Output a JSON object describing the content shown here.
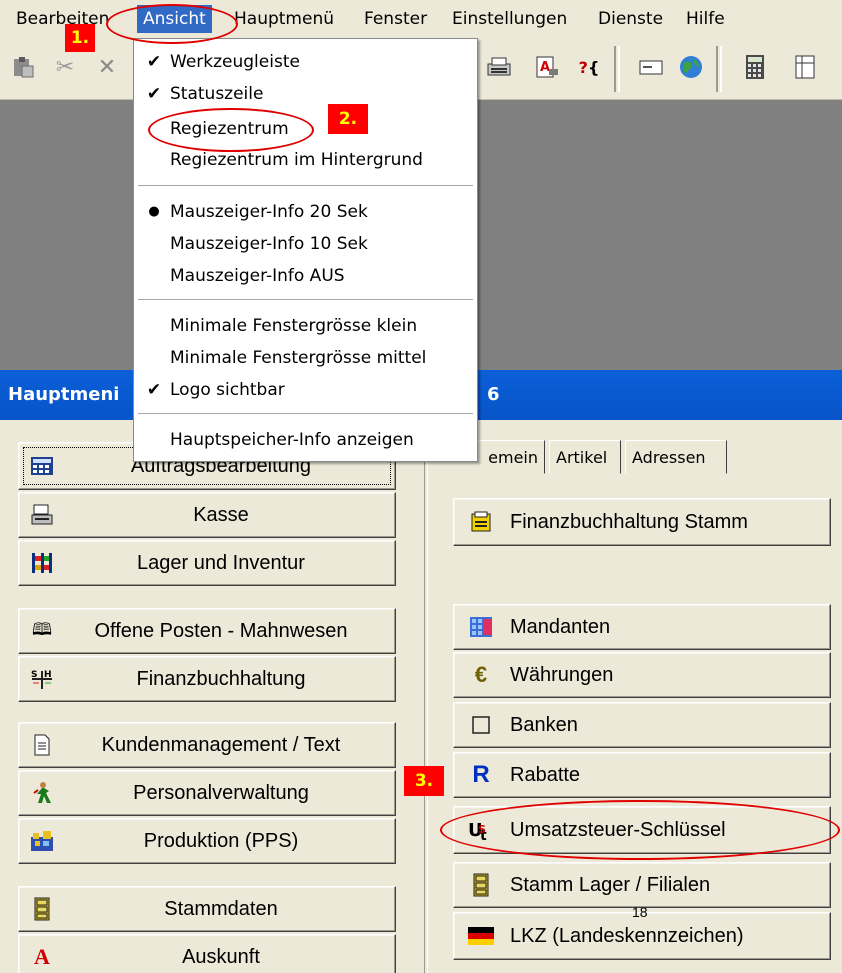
{
  "menubar": {
    "items": [
      {
        "label": "Bearbeiten"
      },
      {
        "label": "Ansicht"
      },
      {
        "label": "Hauptmenü"
      },
      {
        "label": "Fenster"
      },
      {
        "label": "Einstellungen"
      },
      {
        "label": "Dienste"
      },
      {
        "label": "Hilfe"
      }
    ]
  },
  "dropdown": {
    "items": [
      {
        "label": "Werkzeugleiste",
        "mark": "✔"
      },
      {
        "label": "Statuszeile",
        "mark": "✔"
      },
      {
        "label": "Regiezentrum",
        "mark": ""
      },
      {
        "label": "Regiezentrum im Hintergrund",
        "mark": ""
      },
      {
        "label": "Mauszeiger-Info 20 Sek",
        "mark": "●"
      },
      {
        "label": "Mauszeiger-Info 10 Sek",
        "mark": ""
      },
      {
        "label": "Mauszeiger-Info AUS",
        "mark": ""
      },
      {
        "label": "Minimale Fenstergrösse klein",
        "mark": ""
      },
      {
        "label": "Minimale Fenstergrösse mittel",
        "mark": ""
      },
      {
        "label": "Logo sichtbar",
        "mark": "✔"
      },
      {
        "label": "Hauptspeicher-Info anzeigen",
        "mark": ""
      }
    ]
  },
  "window": {
    "title": "Hauptmeni",
    "title_tail": "6"
  },
  "left_buttons": [
    {
      "label": "Auftragsbearbeitung",
      "icon": "calculator-icon"
    },
    {
      "label": "Kasse",
      "icon": "cash-register-icon"
    },
    {
      "label": "Lager und Inventur",
      "icon": "shelf-icon"
    },
    {
      "label": "Offene Posten - Mahnwesen",
      "icon": "book-icon"
    },
    {
      "label": "Finanzbuchhaltung",
      "icon": "ledger-icon"
    },
    {
      "label": "Kundenmanagement / Text",
      "icon": "document-icon"
    },
    {
      "label": "Personalverwaltung",
      "icon": "person-icon"
    },
    {
      "label": "Produktion (PPS)",
      "icon": "factory-icon"
    },
    {
      "label": "Stammdaten",
      "icon": "file-cabinet-icon"
    },
    {
      "label": "Auskunft",
      "icon": "letter-a-icon"
    }
  ],
  "tabs": [
    {
      "label": "emein"
    },
    {
      "label": "Artikel"
    },
    {
      "label": "Adressen"
    }
  ],
  "right_buttons": [
    {
      "label": "Finanzbuchhaltung Stamm",
      "icon": "folder-icon"
    },
    {
      "label": "Mandanten",
      "icon": "grid-icon"
    },
    {
      "label": "Währungen",
      "icon": "euro-icon"
    },
    {
      "label": "Banken",
      "icon": "empty-box-icon"
    },
    {
      "label": "Rabatte",
      "icon": "letter-r-icon"
    },
    {
      "label": "Umsatzsteuer-Schlüssel",
      "icon": "ust-icon"
    },
    {
      "label": "Stamm Lager / Filialen",
      "icon": "file-cabinet-icon"
    },
    {
      "label": "LKZ  (Landeskennzeichen)",
      "icon": "german-flag-icon"
    }
  ],
  "annotations": {
    "step1": "1.",
    "step2": "2.",
    "step3": "3."
  },
  "page_number": "18",
  "colors": {
    "menu_highlight": "#316ac5",
    "titlebar": "#0a5fd8",
    "annotation": "#ff0000",
    "annotation_text": "#ffff00"
  }
}
